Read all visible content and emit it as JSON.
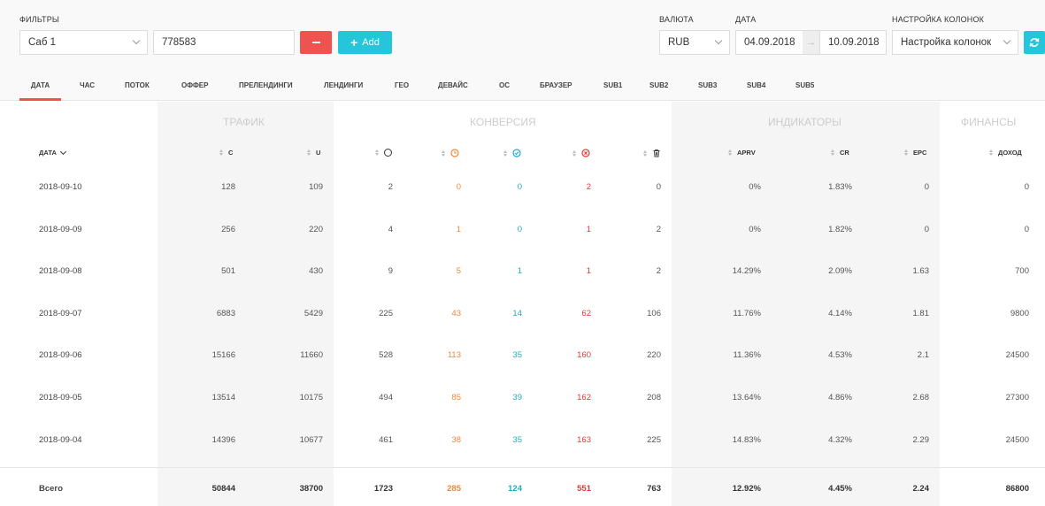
{
  "filters": {
    "label": "ФИЛЬТРЫ",
    "select_value": "Саб 1",
    "input_value": "778583",
    "add_label": "Add"
  },
  "currency": {
    "label": "ВАЛЮТА",
    "value": "RUB"
  },
  "date": {
    "label": "ДАТА",
    "from": "04.09.2018",
    "to": "10.09.2018",
    "arrow": "→"
  },
  "columns_setting": {
    "label": "НАСТРОЙКА КОЛОНОК",
    "value": "Настройка колонок"
  },
  "tabs": [
    "ДАТА",
    "ЧАС",
    "ПОТОК",
    "ОФФЕР",
    "ПРЕЛЕНДИНГИ",
    "ЛЕНДИНГИ",
    "ГЕО",
    "ДЕВАЙС",
    "ОС",
    "БРАУЗЕР",
    "SUB1",
    "SUB2",
    "SUB3",
    "SUB4",
    "SUB5"
  ],
  "active_tab": "ДАТА",
  "groups": {
    "traffic": "ТРАФИК",
    "conversion": "КОНВЕРСИЯ",
    "indicators": "ИНДИКАТОРЫ",
    "finance": "ФИНАНСЫ"
  },
  "headers": {
    "date": "ДАТА",
    "c": "C",
    "u": "U",
    "aprv": "APRV",
    "cr": "CR",
    "epc": "EPC",
    "income": "ДОХОД"
  },
  "conversion_icons": [
    "total-circle-icon",
    "pending-clock-icon",
    "approved-check-icon",
    "rejected-x-icon",
    "trash-icon"
  ],
  "colors": {
    "accent_red": "#ef5350",
    "accent_teal": "#26c6da",
    "pending": "#f0883c",
    "approved": "#26a9c4",
    "rejected": "#e53935"
  },
  "rows": [
    {
      "date": "2018-09-10",
      "c": "128",
      "u": "109",
      "total": "2",
      "pending": "0",
      "approved": "0",
      "rejected": "2",
      "trash": "0",
      "aprv": "0%",
      "cr": "1.83%",
      "epc": "0",
      "income": "0"
    },
    {
      "date": "2018-09-09",
      "c": "256",
      "u": "220",
      "total": "4",
      "pending": "1",
      "approved": "0",
      "rejected": "1",
      "trash": "2",
      "aprv": "0%",
      "cr": "1.82%",
      "epc": "0",
      "income": "0"
    },
    {
      "date": "2018-09-08",
      "c": "501",
      "u": "430",
      "total": "9",
      "pending": "5",
      "approved": "1",
      "rejected": "1",
      "trash": "2",
      "aprv": "14.29%",
      "cr": "2.09%",
      "epc": "1.63",
      "income": "700"
    },
    {
      "date": "2018-09-07",
      "c": "6883",
      "u": "5429",
      "total": "225",
      "pending": "43",
      "approved": "14",
      "rejected": "62",
      "trash": "106",
      "aprv": "11.76%",
      "cr": "4.14%",
      "epc": "1.81",
      "income": "9800"
    },
    {
      "date": "2018-09-06",
      "c": "15166",
      "u": "11660",
      "total": "528",
      "pending": "113",
      "approved": "35",
      "rejected": "160",
      "trash": "220",
      "aprv": "11.36%",
      "cr": "4.53%",
      "epc": "2.1",
      "income": "24500"
    },
    {
      "date": "2018-09-05",
      "c": "13514",
      "u": "10175",
      "total": "494",
      "pending": "85",
      "approved": "39",
      "rejected": "162",
      "trash": "208",
      "aprv": "13.64%",
      "cr": "4.86%",
      "epc": "2.68",
      "income": "27300"
    },
    {
      "date": "2018-09-04",
      "c": "14396",
      "u": "10677",
      "total": "461",
      "pending": "38",
      "approved": "35",
      "rejected": "163",
      "trash": "225",
      "aprv": "14.83%",
      "cr": "4.32%",
      "epc": "2.29",
      "income": "24500"
    }
  ],
  "totals": {
    "label": "Всего",
    "c": "50844",
    "u": "38700",
    "total": "1723",
    "pending": "285",
    "approved": "124",
    "rejected": "551",
    "trash": "763",
    "aprv": "12.92%",
    "cr": "4.45%",
    "epc": "2.24",
    "income": "86800"
  }
}
